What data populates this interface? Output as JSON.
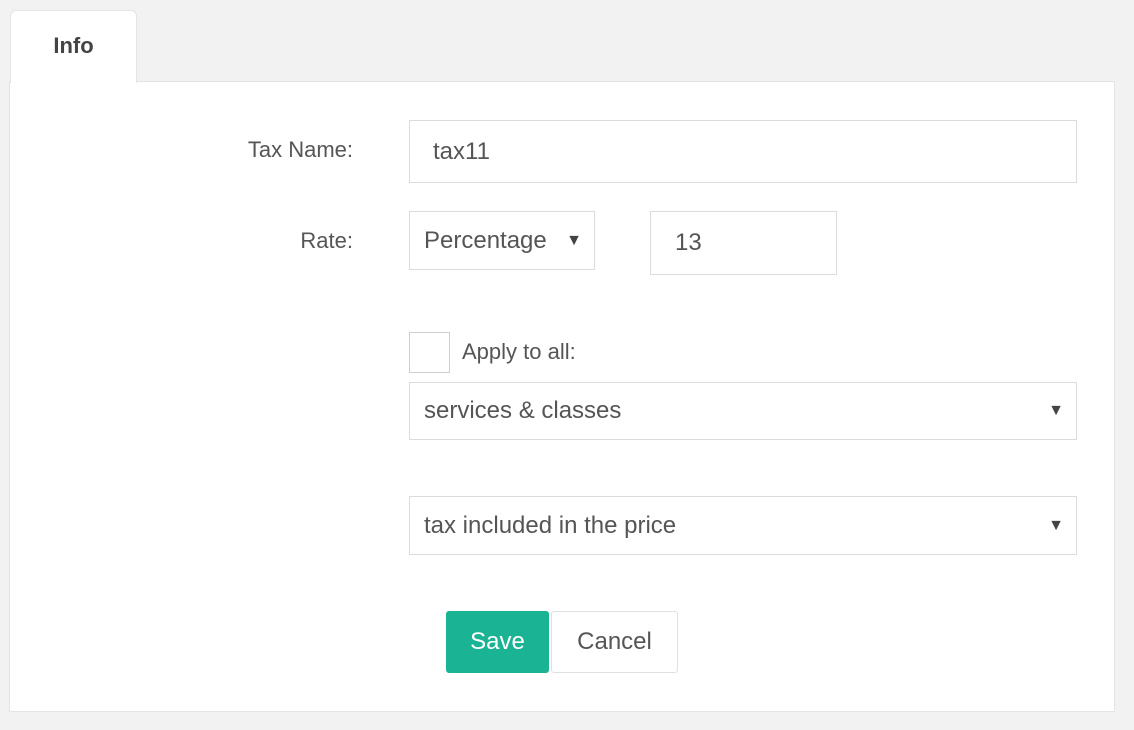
{
  "tabs": [
    {
      "label": "Info",
      "active": true
    }
  ],
  "form": {
    "tax_name_label": "Tax Name:",
    "tax_name_value": "tax11",
    "rate_label": "Rate:",
    "rate_type_value": "Percentage",
    "rate_value": "13",
    "apply_all_label": "Apply to all:",
    "apply_all_checked": false,
    "apply_scope_value": "services & classes",
    "tax_mode_value": "tax included in the price"
  },
  "actions": {
    "save_label": "Save",
    "cancel_label": "Cancel"
  },
  "colors": {
    "accent": "#1ab394",
    "background": "#f2f2f2",
    "panel": "#ffffff",
    "text": "#555555"
  },
  "icons": {
    "dropdown": "chevron-down-icon"
  }
}
